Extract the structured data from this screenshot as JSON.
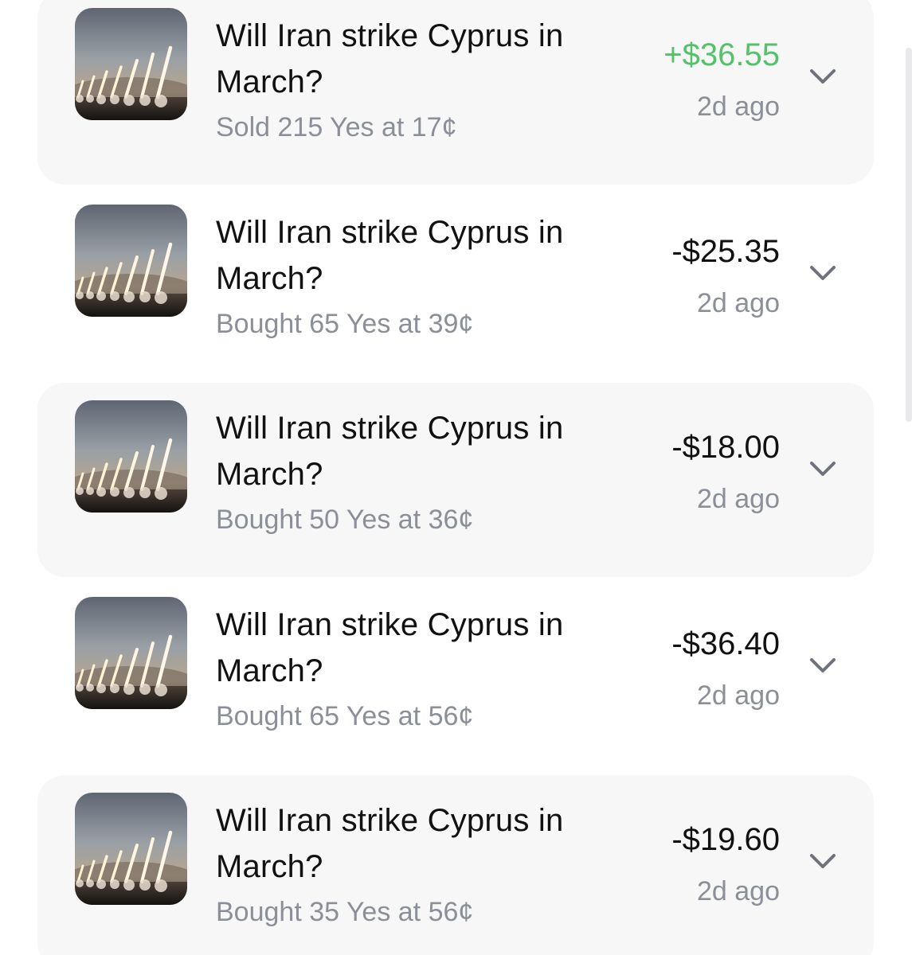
{
  "trades": [
    {
      "title": "Will Iran strike Cyprus in March?",
      "detail": "Sold 215 Yes at 17¢",
      "amount": "+$36.55",
      "time": "2d ago",
      "positive": true
    },
    {
      "title": "Will Iran strike Cyprus in March?",
      "detail": "Bought 65 Yes at 39¢",
      "amount": "-$25.35",
      "time": "2d ago",
      "positive": false
    },
    {
      "title": "Will Iran strike Cyprus in March?",
      "detail": "Bought 50 Yes at 36¢",
      "amount": "-$18.00",
      "time": "2d ago",
      "positive": false
    },
    {
      "title": "Will Iran strike Cyprus in March?",
      "detail": "Bought 65 Yes at 56¢",
      "amount": "-$36.40",
      "time": "2d ago",
      "positive": false
    },
    {
      "title": "Will Iran strike Cyprus in March?",
      "detail": "Bought 35 Yes at 56¢",
      "amount": "-$19.60",
      "time": "2d ago",
      "positive": false
    }
  ],
  "icons": {
    "expand": "chevron-down-icon",
    "thumbnail": "missile-launch-thumbnail"
  },
  "colors": {
    "positive": "#54c26a",
    "text": "#111111",
    "muted": "#8a8f98",
    "row_bg": "#f7f7f8"
  }
}
